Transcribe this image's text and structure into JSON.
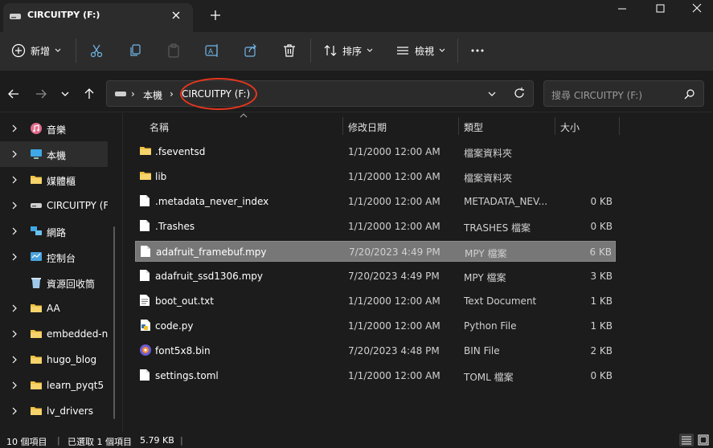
{
  "window": {
    "tab_title": "CIRCUITPY (F:)",
    "icons": [
      "drive-icon",
      "close-icon",
      "plus-icon",
      "minimize-icon",
      "maximize-icon",
      "window-close-icon"
    ]
  },
  "toolbar": {
    "new_label": "新增",
    "sort_label": "排序",
    "view_label": "檢視",
    "icons": [
      "cut-icon",
      "copy-icon",
      "paste-icon",
      "rename-icon",
      "share-icon",
      "delete-icon",
      "more-icon"
    ]
  },
  "address": {
    "crumb_computer": "本機",
    "crumb_drive": "CIRCUITPY (F:)",
    "search_placeholder": "搜尋 CIRCUITPY (F:)"
  },
  "sidebar": {
    "items": [
      {
        "label": "音樂",
        "icon": "music-icon"
      },
      {
        "label": "本機",
        "icon": "computer-icon",
        "selected": true
      },
      {
        "label": "媒體櫃",
        "icon": "folder-icon"
      },
      {
        "label": "CIRCUITPY (F:)",
        "icon": "drive-icon"
      },
      {
        "label": "網路",
        "icon": "network-icon"
      },
      {
        "label": "控制台",
        "icon": "control-panel-icon"
      },
      {
        "label": "資源回收筒",
        "icon": "recycle-bin-icon"
      },
      {
        "label": "AA",
        "icon": "folder-icon"
      },
      {
        "label": "embedded-n",
        "icon": "folder-icon"
      },
      {
        "label": "hugo_blog",
        "icon": "folder-icon"
      },
      {
        "label": "learn_pyqt5",
        "icon": "folder-icon"
      },
      {
        "label": "lv_drivers",
        "icon": "folder-icon"
      }
    ]
  },
  "columns": {
    "name": "名稱",
    "date": "修改日期",
    "type": "類型",
    "size": "大小"
  },
  "files": [
    {
      "name": ".fseventsd",
      "date": "1/1/2000 12:00 AM",
      "type": "檔案資料夾",
      "size": "",
      "icon": "folder-icon"
    },
    {
      "name": "lib",
      "date": "1/1/2000 12:00 AM",
      "type": "檔案資料夾",
      "size": "",
      "icon": "folder-icon"
    },
    {
      "name": ".metadata_never_index",
      "date": "1/1/2000 12:00 AM",
      "type": "METADATA_NEV...",
      "size": "0 KB",
      "icon": "file-icon"
    },
    {
      "name": ".Trashes",
      "date": "1/1/2000 12:00 AM",
      "type": "TRASHES 檔案",
      "size": "0 KB",
      "icon": "file-icon"
    },
    {
      "name": "adafruit_framebuf.mpy",
      "date": "7/20/2023 4:49 PM",
      "type": "MPY 檔案",
      "size": "6 KB",
      "icon": "file-icon",
      "selected": true
    },
    {
      "name": "adafruit_ssd1306.mpy",
      "date": "7/20/2023 4:49 PM",
      "type": "MPY 檔案",
      "size": "3 KB",
      "icon": "file-icon"
    },
    {
      "name": "boot_out.txt",
      "date": "1/1/2000 12:00 AM",
      "type": "Text Document",
      "size": "1 KB",
      "icon": "text-file-icon"
    },
    {
      "name": "code.py",
      "date": "1/1/2000 12:00 AM",
      "type": "Python File",
      "size": "1 KB",
      "icon": "python-file-icon"
    },
    {
      "name": "font5x8.bin",
      "date": "7/20/2023 4:48 PM",
      "type": "BIN File",
      "size": "2 KB",
      "icon": "bin-file-icon"
    },
    {
      "name": "settings.toml",
      "date": "1/1/2000 12:00 AM",
      "type": "TOML 檔案",
      "size": "0 KB",
      "icon": "file-icon"
    }
  ],
  "status": {
    "count": "10 個項目",
    "selected": "已選取 1 個項目",
    "size": "5.79 KB"
  },
  "colors": {
    "accent_annotation": "#e8361e",
    "folder": "#f0c244",
    "selection": "#777777"
  }
}
